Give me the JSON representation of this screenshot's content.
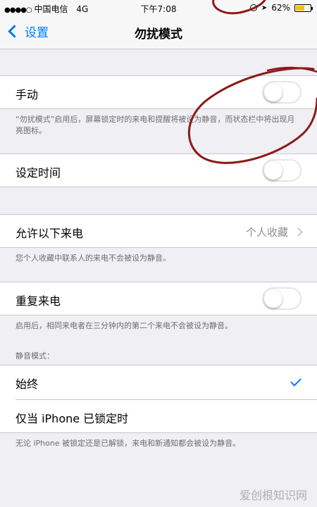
{
  "status_bar": {
    "signal": "●●●●○",
    "carrier": "中国电信",
    "network": "4G",
    "time": "下午7:08",
    "battery": "62%",
    "battery_level": 0.62
  },
  "nav": {
    "back_label": "设置",
    "title": "勿扰模式"
  },
  "manual": {
    "label": "手动",
    "on": false,
    "footnote": "“勿扰模式”启用后，屏幕锁定时的来电和提醒将被设为静音，而状态栏中将出现月亮图标。"
  },
  "scheduled": {
    "label": "设定时间",
    "on": false
  },
  "allow_calls": {
    "label": "允许以下来电",
    "value": "个人收藏",
    "footnote": "您个人收藏中联系人的来电不会被设为静音。"
  },
  "repeated_calls": {
    "label": "重复来电",
    "on": false,
    "footnote": "启用后，相同来电者在三分钟内的第二个来电不会被设为静音。"
  },
  "silence": {
    "header": "静音模式：",
    "options": [
      "始终",
      "仅当 iPhone 已锁定时"
    ],
    "selected": 0,
    "footnote": "无论 iPhone 被锁定还是已解锁，来电和新通知都会被设为静音。"
  },
  "watermark": "爱创根知识网",
  "colors": {
    "accent": "#007aff",
    "annotation": "#8b1a1a",
    "battery": "#f5c400"
  }
}
